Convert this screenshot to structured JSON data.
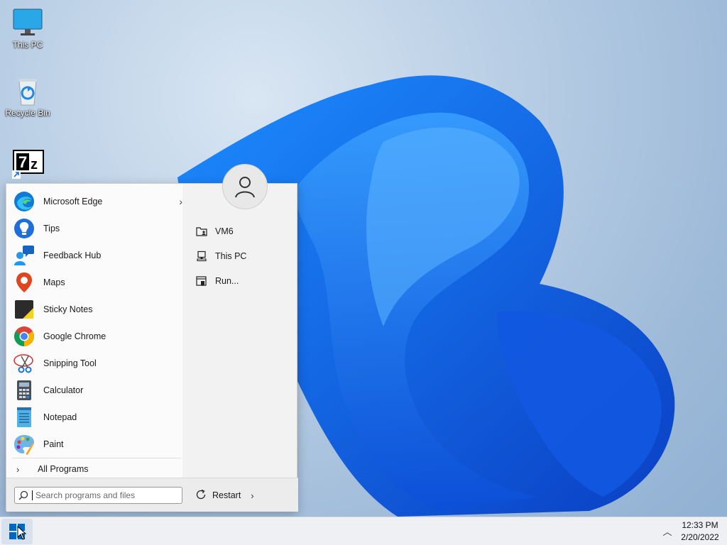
{
  "desktop": {
    "icons": [
      {
        "label": "This PC",
        "icon": "monitor-icon"
      },
      {
        "label": "Recycle Bin",
        "icon": "recycle-bin-icon"
      },
      {
        "label": "",
        "icon": "7zip-shortcut-icon"
      }
    ]
  },
  "start_menu": {
    "programs": [
      {
        "label": "Microsoft Edge",
        "icon": "edge-icon",
        "has_submenu": true
      },
      {
        "label": "Tips",
        "icon": "tips-icon"
      },
      {
        "label": "Feedback Hub",
        "icon": "feedback-hub-icon"
      },
      {
        "label": "Maps",
        "icon": "maps-icon"
      },
      {
        "label": "Sticky Notes",
        "icon": "sticky-notes-icon"
      },
      {
        "label": "Google Chrome",
        "icon": "chrome-icon"
      },
      {
        "label": "Snipping Tool",
        "icon": "snipping-tool-icon"
      },
      {
        "label": "Calculator",
        "icon": "calculator-icon"
      },
      {
        "label": "Notepad",
        "icon": "notepad-icon"
      },
      {
        "label": "Paint",
        "icon": "paint-icon"
      }
    ],
    "all_programs_label": "All Programs",
    "places": [
      {
        "label": "VM6",
        "icon": "user-folder-icon"
      },
      {
        "label": "This PC",
        "icon": "computer-icon"
      },
      {
        "label": "Run...",
        "icon": "run-icon"
      }
    ],
    "search": {
      "placeholder": "Search programs and files"
    },
    "power": {
      "label": "Restart"
    }
  },
  "taskbar": {
    "clock": {
      "time": "12:33 PM",
      "date": "2/20/2022"
    }
  },
  "colors": {
    "accent": "#0067c0",
    "menu_bg": "#f2f2f2",
    "taskbar_bg": "#eef0f3"
  }
}
